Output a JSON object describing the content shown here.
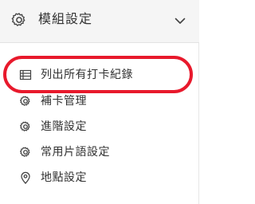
{
  "header": {
    "title": "模組設定",
    "icon": "gear-icon",
    "toggle_icon": "chevron-down-icon"
  },
  "menu": {
    "items": [
      {
        "label": "列出所有打卡紀錄",
        "icon": "list-table-icon"
      },
      {
        "label": "補卡管理",
        "icon": "gear-icon"
      },
      {
        "label": "進階設定",
        "icon": "gear-icon"
      },
      {
        "label": "常用片語設定",
        "icon": "gear-icon"
      },
      {
        "label": "地點設定",
        "icon": "map-pin-icon"
      }
    ]
  },
  "annotation": {
    "highlight_color": "#e8192c"
  }
}
